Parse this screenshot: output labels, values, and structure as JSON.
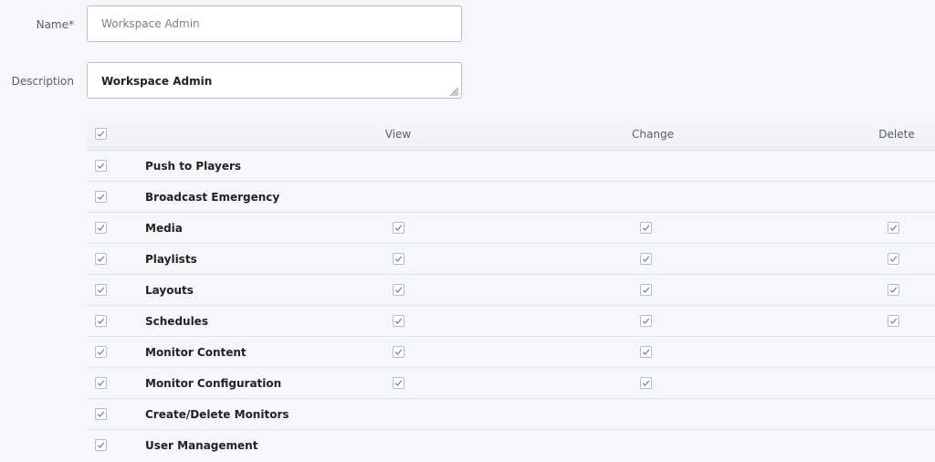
{
  "form": {
    "name_label": "Name*",
    "name_value": "Workspace Admin",
    "description_label": "Description",
    "description_value": "Workspace Admin"
  },
  "table": {
    "headers": {
      "view": "View",
      "change": "Change",
      "delete": "Delete"
    },
    "select_all_checked": true,
    "rows": [
      {
        "label": "Push to Players",
        "selected": true,
        "view": null,
        "change": null,
        "delete": null
      },
      {
        "label": "Broadcast Emergency",
        "selected": true,
        "view": null,
        "change": null,
        "delete": null
      },
      {
        "label": "Media",
        "selected": true,
        "view": true,
        "change": true,
        "delete": true
      },
      {
        "label": "Playlists",
        "selected": true,
        "view": true,
        "change": true,
        "delete": true
      },
      {
        "label": "Layouts",
        "selected": true,
        "view": true,
        "change": true,
        "delete": true
      },
      {
        "label": "Schedules",
        "selected": true,
        "view": true,
        "change": true,
        "delete": true
      },
      {
        "label": "Monitor Content",
        "selected": true,
        "view": true,
        "change": true,
        "delete": null
      },
      {
        "label": "Monitor Configuration",
        "selected": true,
        "view": true,
        "change": true,
        "delete": null
      },
      {
        "label": "Create/Delete Monitors",
        "selected": true,
        "view": null,
        "change": null,
        "delete": null
      },
      {
        "label": "User Management",
        "selected": true,
        "view": null,
        "change": null,
        "delete": null
      }
    ]
  },
  "icons": {
    "checkbox": "checkmark-icon",
    "resize": "resize-grip-icon"
  },
  "colors": {
    "background": "#f6f7fa",
    "input_border": "#b9bec6",
    "check": "#6b7079"
  }
}
